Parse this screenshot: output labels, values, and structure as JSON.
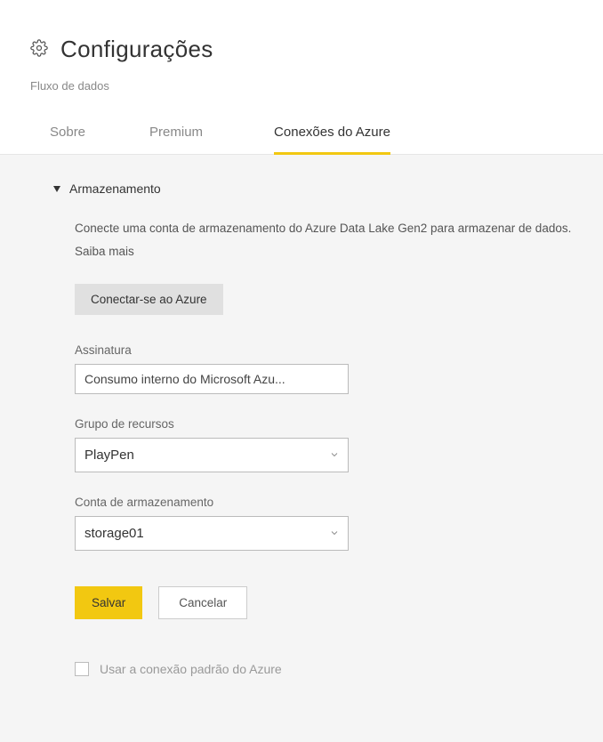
{
  "header": {
    "title": "Configurações",
    "subtitle": "Fluxo de dados"
  },
  "tabs": {
    "items": [
      {
        "label": "Sobre"
      },
      {
        "label": "Premium"
      },
      {
        "label": "Conexões do Azure"
      }
    ]
  },
  "section": {
    "title": "Armazenamento",
    "description": "Conecte uma conta de armazenamento do Azure Data Lake Gen2 para armazenar de dados.",
    "learn_more": "Saiba mais",
    "connect_button": "Conectar-se ao Azure"
  },
  "form": {
    "subscription": {
      "label": "Assinatura",
      "value": "Consumo interno do Microsoft Azu..."
    },
    "resource_group": {
      "label": "Grupo de recursos",
      "value": "PlayPen"
    },
    "storage_account": {
      "label": "Conta de armazenamento",
      "value": "storage01"
    }
  },
  "actions": {
    "save": "Salvar",
    "cancel": "Cancelar"
  },
  "checkbox": {
    "label": "Usar a conexão padrão do Azure"
  }
}
